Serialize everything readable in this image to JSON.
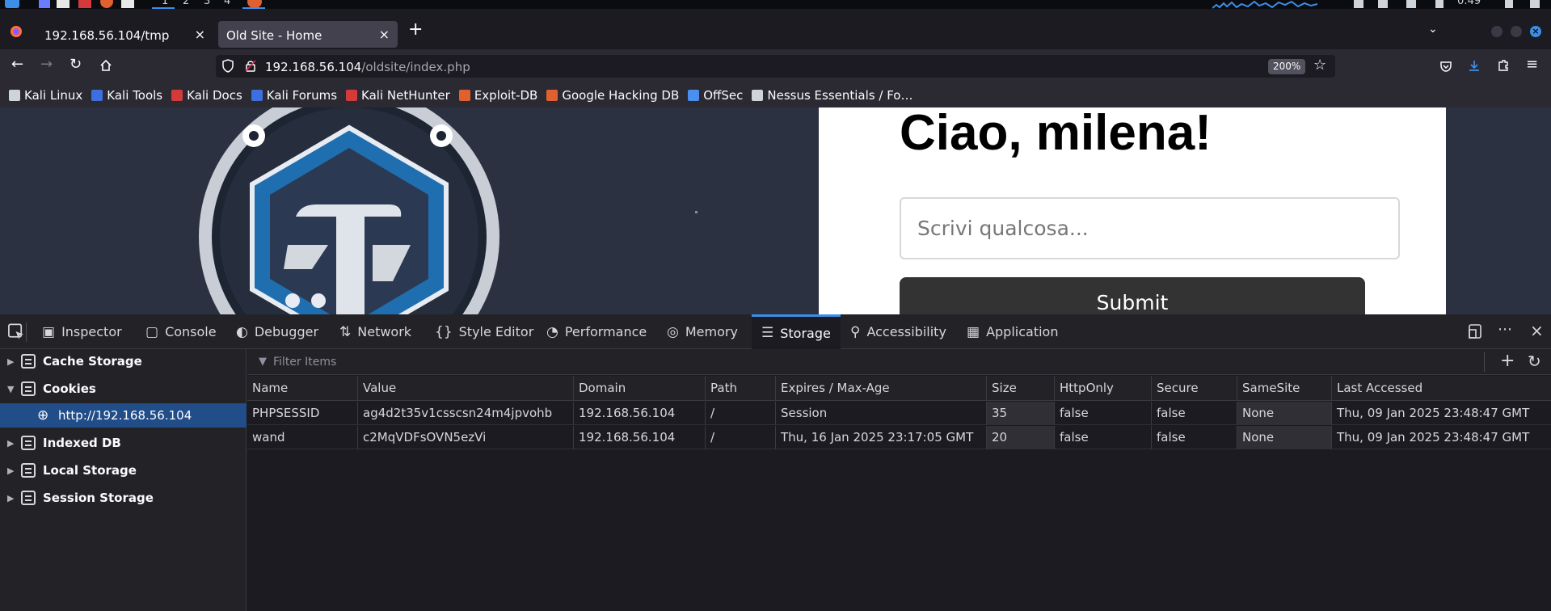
{
  "top_panel": {
    "workspaces": [
      "1",
      "2",
      "3",
      "4"
    ],
    "clock": "0:49"
  },
  "tabs": [
    {
      "title": "192.168.56.104/tmp",
      "close": "×",
      "active": false
    },
    {
      "title": "Old Site - Home",
      "close": "×",
      "active": true
    }
  ],
  "new_tab_label": "+",
  "navigation": {
    "url_host": "192.168.56.104",
    "url_path": "/oldsite/index.php",
    "zoom": "200%"
  },
  "bookmarks": [
    {
      "label": "Kali Linux",
      "color": "#cfd3da"
    },
    {
      "label": "Kali Tools",
      "color": "#3d6fe0"
    },
    {
      "label": "Kali Docs",
      "color": "#d53a3a"
    },
    {
      "label": "Kali Forums",
      "color": "#3d6fe0"
    },
    {
      "label": "Kali NetHunter",
      "color": "#d53a3a"
    },
    {
      "label": "Exploit-DB",
      "color": "#e06030"
    },
    {
      "label": "Google Hacking DB",
      "color": "#e06030"
    },
    {
      "label": "OffSec",
      "color": "#4a8ef0"
    },
    {
      "label": "Nessus Essentials / Fo…",
      "color": "#cfd3da"
    }
  ],
  "page": {
    "greeting": "Ciao, milena!",
    "input_placeholder": "Scrivi qualcosa...",
    "submit_label": "Submit"
  },
  "devtools": {
    "tabs": [
      {
        "label": "Inspector",
        "icon": "inspector-icon"
      },
      {
        "label": "Console",
        "icon": "console-icon"
      },
      {
        "label": "Debugger",
        "icon": "debugger-icon"
      },
      {
        "label": "Network",
        "icon": "network-icon"
      },
      {
        "label": "Style Editor",
        "icon": "style-editor-icon"
      },
      {
        "label": "Performance",
        "icon": "performance-icon"
      },
      {
        "label": "Memory",
        "icon": "memory-icon"
      },
      {
        "label": "Storage",
        "icon": "storage-icon",
        "active": true
      },
      {
        "label": "Accessibility",
        "icon": "accessibility-icon"
      },
      {
        "label": "Application",
        "icon": "application-icon"
      }
    ],
    "sidebar": [
      {
        "label": "Cache Storage",
        "expanded": false
      },
      {
        "label": "Cookies",
        "expanded": true
      },
      {
        "label": "http://192.168.56.104",
        "child": true,
        "selected": true
      },
      {
        "label": "Indexed DB",
        "expanded": false
      },
      {
        "label": "Local Storage",
        "expanded": false
      },
      {
        "label": "Session Storage",
        "expanded": false
      }
    ],
    "filter_placeholder": "Filter Items",
    "columns": [
      "Name",
      "Value",
      "Domain",
      "Path",
      "Expires / Max-Age",
      "Size",
      "HttpOnly",
      "Secure",
      "SameSite",
      "Last Accessed"
    ],
    "rows": [
      [
        "PHPSESSID",
        "ag4d2t35v1csscsn24m4jpvohb",
        "192.168.56.104",
        "/",
        "Session",
        "35",
        "false",
        "false",
        "None",
        "Thu, 09 Jan 2025 23:48:47 GMT"
      ],
      [
        "wand",
        "c2MqVDFsOVN5ezVi",
        "192.168.56.104",
        "/",
        "Thu, 16 Jan 2025 23:17:05 GMT",
        "20",
        "false",
        "false",
        "None",
        "Thu, 09 Jan 2025 23:48:47 GMT"
      ]
    ]
  },
  "colors": {
    "accent": "#3d8ee9",
    "selection": "#214d88",
    "page_bg": "#2b3140"
  }
}
